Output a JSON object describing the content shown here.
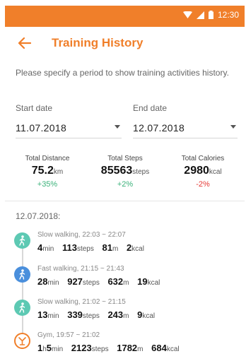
{
  "status_bar": {
    "time": "12:30"
  },
  "app_bar": {
    "title": "Training History"
  },
  "description": "Please specify a period to show training activities history.",
  "start_date": {
    "label": "Start date",
    "value": "11.07.2018"
  },
  "end_date": {
    "label": "End date",
    "value": "12.07.2018"
  },
  "stats": [
    {
      "label": "Total Distance",
      "value": "75.2",
      "unit": "km",
      "change": "+35%",
      "change_color": "#3bb27a"
    },
    {
      "label": "Total Steps",
      "value": "85563",
      "unit": "steps",
      "change": "+2%",
      "change_color": "#3bb27a"
    },
    {
      "label": "Total Calories",
      "value": "2980",
      "unit": "kcal",
      "change": "-2%",
      "change_color": "#e53935"
    }
  ],
  "section_date": "12.07.2018:",
  "activities": [
    {
      "title": "Slow walking, 22:03 ~ 22:07",
      "icon": "walking-icon",
      "icon_color": "#5dc9b3",
      "duration": {
        "value": "4",
        "unit": "min"
      },
      "steps": {
        "value": "113",
        "unit": "steps"
      },
      "distance": {
        "value": "81",
        "unit": "m"
      },
      "calories": {
        "value": "2",
        "unit": "kcal"
      }
    },
    {
      "title": "Fast walking, 21:15 ~ 21:43",
      "icon": "walking-icon",
      "icon_color": "#4a8fdc",
      "duration": {
        "value": "28",
        "unit": "min"
      },
      "steps": {
        "value": "927",
        "unit": "steps"
      },
      "distance": {
        "value": "632",
        "unit": "m"
      },
      "calories": {
        "value": "19",
        "unit": "kcal"
      }
    },
    {
      "title": "Slow walking, 21:02 ~ 21:15",
      "icon": "walking-icon",
      "icon_color": "#5dc9b3",
      "duration": {
        "value": "13",
        "unit": "min"
      },
      "steps": {
        "value": "339",
        "unit": "steps"
      },
      "distance": {
        "value": "243",
        "unit": "m"
      },
      "calories": {
        "value": "9",
        "unit": "kcal"
      }
    },
    {
      "title": "Gym, 19:57 ~ 21:02",
      "icon": "gym-icon",
      "icon_color": "#f07f2a",
      "duration": {
        "hours": "1",
        "hours_unit": "h",
        "value": "5",
        "unit": "min"
      },
      "steps": {
        "value": "2123",
        "unit": "steps"
      },
      "distance": {
        "value": "1782",
        "unit": "m"
      },
      "calories": {
        "value": "684",
        "unit": "kcal"
      }
    }
  ],
  "colors": {
    "accent": "#f07f2a",
    "positive": "#3bb27a",
    "negative": "#e53935"
  }
}
